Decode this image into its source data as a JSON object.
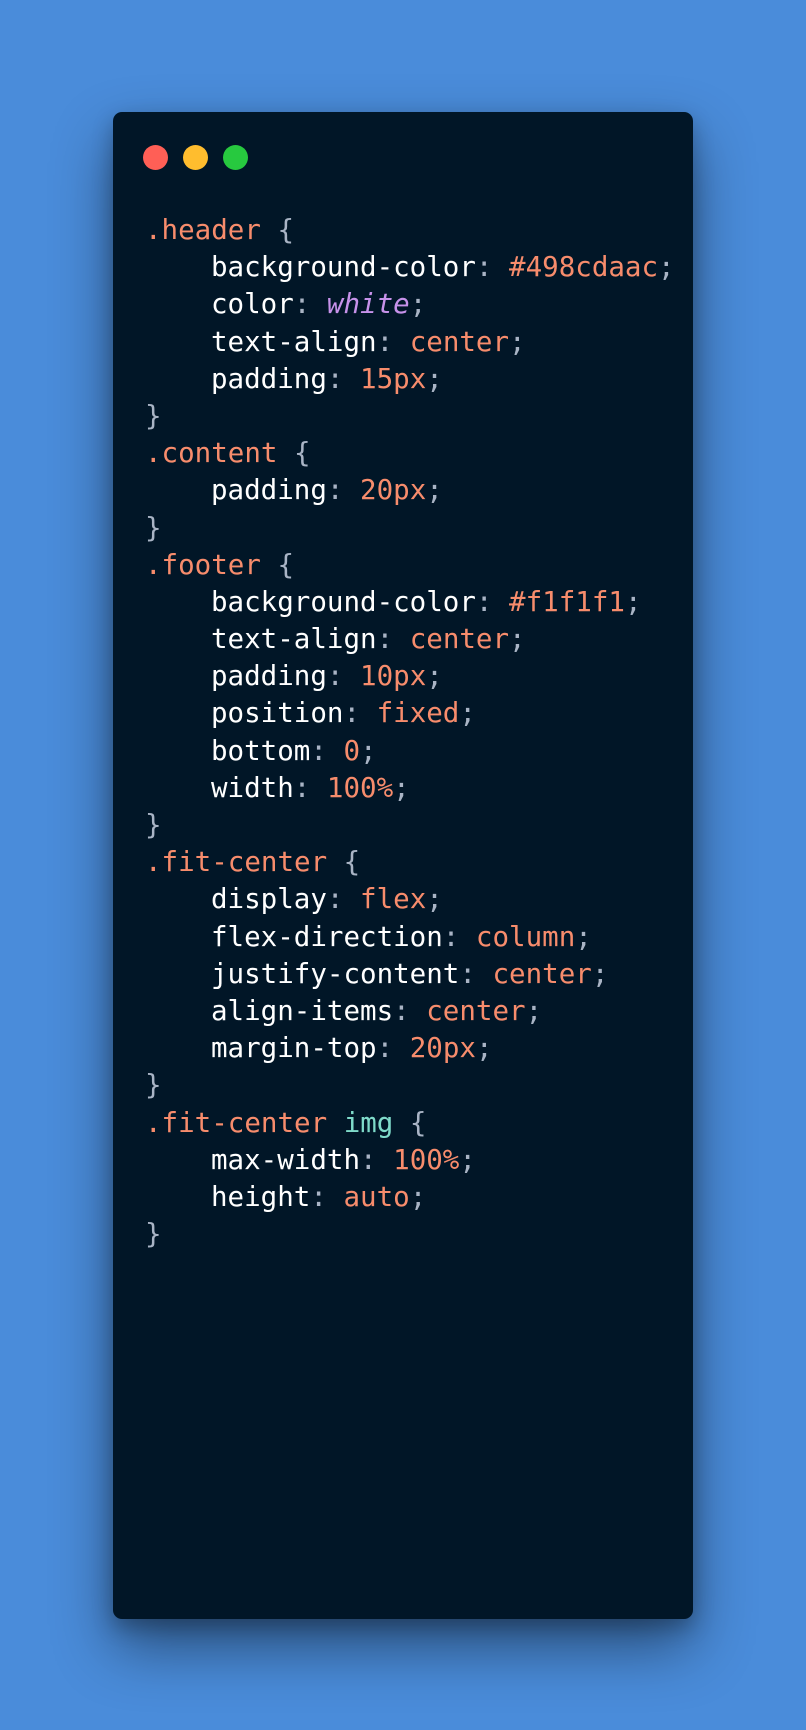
{
  "colors": {
    "background": "#4a8cda",
    "window": "#011627",
    "close_dot": "#ff5f56",
    "minimize_dot": "#ffbd2e",
    "maximize_dot": "#27c93f",
    "selector": "#f78c6c",
    "element_selector": "#7fdbca",
    "property": "#ffffff",
    "value": "#f78c6c",
    "keyword_value": "#c792ea",
    "punctuation": "#a9b4c5"
  },
  "window_controls": [
    "close-dot",
    "minimize-dot",
    "maximize-dot"
  ],
  "code": {
    "rules": [
      {
        "selector": ".header",
        "declarations": [
          {
            "property": "background-color",
            "value": "#498cdaac",
            "style": "value"
          },
          {
            "property": "color",
            "value": "white",
            "style": "keyword"
          },
          {
            "property": "text-align",
            "value": "center",
            "style": "value"
          },
          {
            "property": "padding",
            "value": "15px",
            "style": "value"
          }
        ]
      },
      {
        "selector": ".content",
        "declarations": [
          {
            "property": "padding",
            "value": "20px",
            "style": "value"
          }
        ]
      },
      {
        "selector": ".footer",
        "declarations": [
          {
            "property": "background-color",
            "value": "#f1f1f1",
            "style": "value"
          },
          {
            "property": "text-align",
            "value": "center",
            "style": "value"
          },
          {
            "property": "padding",
            "value": "10px",
            "style": "value"
          },
          {
            "property": "position",
            "value": "fixed",
            "style": "value"
          },
          {
            "property": "bottom",
            "value": "0",
            "style": "value"
          },
          {
            "property": "width",
            "value": "100%",
            "style": "value"
          }
        ]
      },
      {
        "selector": ".fit-center",
        "declarations": [
          {
            "property": "display",
            "value": "flex",
            "style": "value"
          },
          {
            "property": "flex-direction",
            "value": "column",
            "style": "value"
          },
          {
            "property": "justify-content",
            "value": "center",
            "style": "value"
          },
          {
            "property": "align-items",
            "value": "center",
            "style": "value"
          },
          {
            "property": "margin-top",
            "value": "20px",
            "style": "value"
          }
        ]
      },
      {
        "selector": ".fit-center",
        "element": "img",
        "declarations": [
          {
            "property": "max-width",
            "value": "100%",
            "style": "value"
          },
          {
            "property": "height",
            "value": "auto",
            "style": "value"
          }
        ]
      }
    ]
  }
}
